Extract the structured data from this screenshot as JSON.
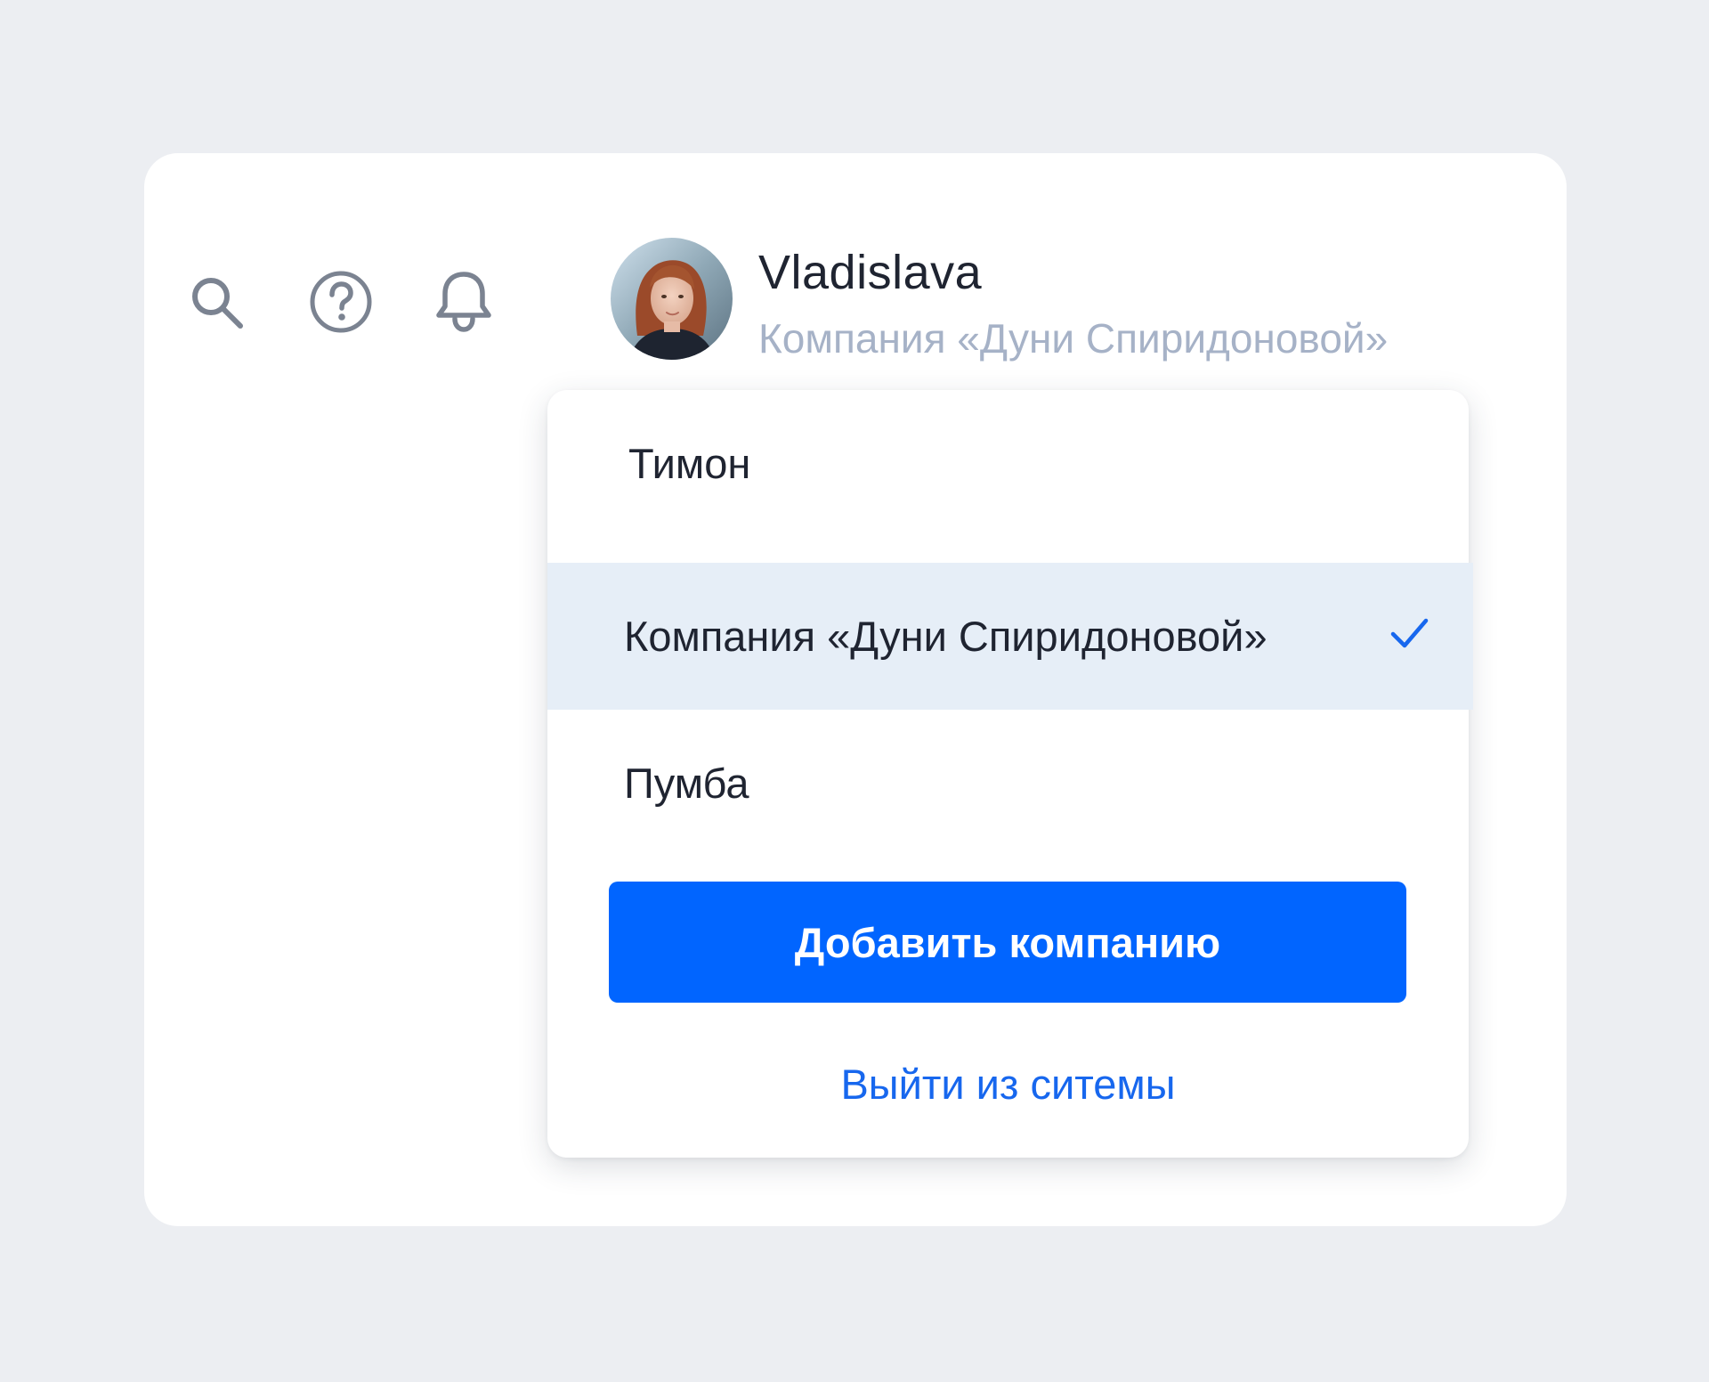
{
  "colors": {
    "background": "#eceef2",
    "card": "#ffffff",
    "accent": "#0165ff",
    "link": "#1767ee",
    "selected_row": "#e6eef7",
    "icon": "#7b8391",
    "text_primary": "#1f2431",
    "text_secondary": "#a6b2c7"
  },
  "toolbar": {
    "icons": [
      "search-icon",
      "help-icon",
      "bell-icon"
    ]
  },
  "user": {
    "name": "Vladislava",
    "company": "Компания «Дуни Спиридоновой»"
  },
  "dropdown": {
    "items": [
      {
        "label": "Тимон",
        "selected": false
      },
      {
        "label": "Компания «Дуни Спиридоновой»",
        "selected": true
      },
      {
        "label": "Пумба",
        "selected": false
      }
    ],
    "add_button_label": "Добавить компанию",
    "logout_label": "Выйти из ситемы"
  }
}
